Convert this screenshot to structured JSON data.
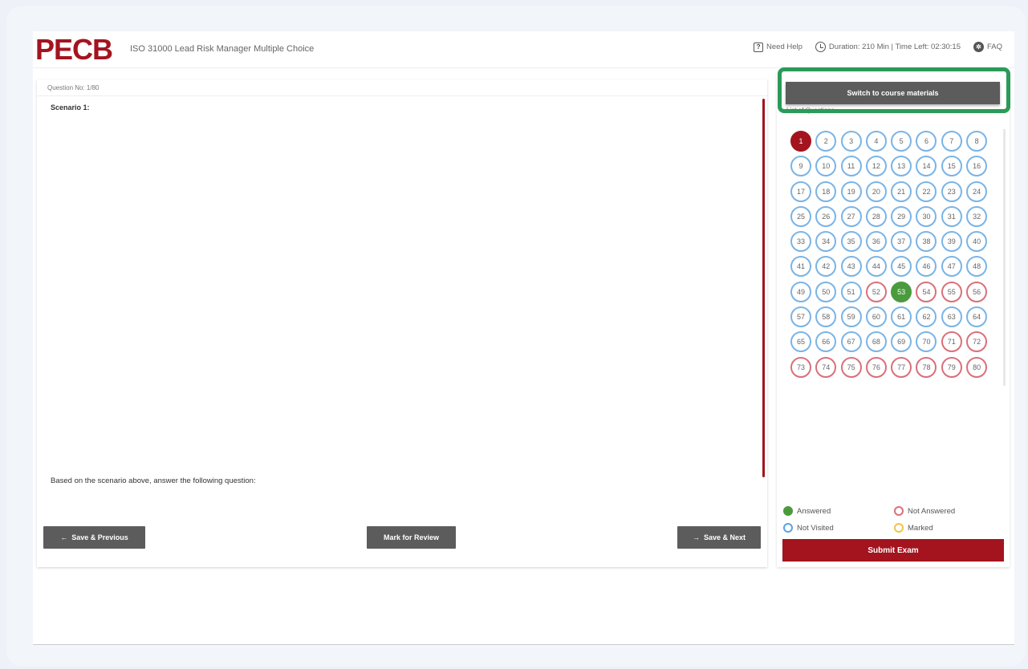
{
  "header": {
    "logo": "PECB",
    "exam_title": "ISO 31000 Lead Risk Manager Multiple Choice",
    "need_help": "Need Help",
    "duration": "Duration: 210 Min | Time Left: 02:30:15",
    "faq": "FAQ"
  },
  "question": {
    "number_label": "Question No: 1/80",
    "scenario_title": "Scenario 1:",
    "prompt": "Based on the scenario above, answer the following question:"
  },
  "nav": {
    "prev_label": "Save & Previous",
    "review_label": "Mark for Review",
    "next_label": "Save & Next"
  },
  "sidebar": {
    "switch_label": "Switch to course materials",
    "list_label": "List of Questions",
    "questions": [
      {
        "n": "1",
        "s": "current"
      },
      {
        "n": "2",
        "s": "not-visited"
      },
      {
        "n": "3",
        "s": "not-visited"
      },
      {
        "n": "4",
        "s": "not-visited"
      },
      {
        "n": "5",
        "s": "not-visited"
      },
      {
        "n": "6",
        "s": "not-visited"
      },
      {
        "n": "7",
        "s": "not-visited"
      },
      {
        "n": "8",
        "s": "not-visited"
      },
      {
        "n": "9",
        "s": "not-visited"
      },
      {
        "n": "10",
        "s": "not-visited"
      },
      {
        "n": "11",
        "s": "not-visited"
      },
      {
        "n": "12",
        "s": "not-visited"
      },
      {
        "n": "13",
        "s": "not-visited"
      },
      {
        "n": "14",
        "s": "not-visited"
      },
      {
        "n": "15",
        "s": "not-visited"
      },
      {
        "n": "16",
        "s": "not-visited"
      },
      {
        "n": "17",
        "s": "not-visited"
      },
      {
        "n": "18",
        "s": "not-visited"
      },
      {
        "n": "19",
        "s": "not-visited"
      },
      {
        "n": "20",
        "s": "not-visited"
      },
      {
        "n": "21",
        "s": "not-visited"
      },
      {
        "n": "22",
        "s": "not-visited"
      },
      {
        "n": "23",
        "s": "not-visited"
      },
      {
        "n": "24",
        "s": "not-visited"
      },
      {
        "n": "25",
        "s": "not-visited"
      },
      {
        "n": "26",
        "s": "not-visited"
      },
      {
        "n": "27",
        "s": "not-visited"
      },
      {
        "n": "28",
        "s": "not-visited"
      },
      {
        "n": "29",
        "s": "not-visited"
      },
      {
        "n": "30",
        "s": "not-visited"
      },
      {
        "n": "31",
        "s": "not-visited"
      },
      {
        "n": "32",
        "s": "not-visited"
      },
      {
        "n": "33",
        "s": "not-visited"
      },
      {
        "n": "34",
        "s": "not-visited"
      },
      {
        "n": "35",
        "s": "not-visited"
      },
      {
        "n": "36",
        "s": "not-visited"
      },
      {
        "n": "37",
        "s": "not-visited"
      },
      {
        "n": "38",
        "s": "not-visited"
      },
      {
        "n": "39",
        "s": "not-visited"
      },
      {
        "n": "40",
        "s": "not-visited"
      },
      {
        "n": "41",
        "s": "not-visited"
      },
      {
        "n": "42",
        "s": "not-visited"
      },
      {
        "n": "43",
        "s": "not-visited"
      },
      {
        "n": "44",
        "s": "not-visited"
      },
      {
        "n": "45",
        "s": "not-visited"
      },
      {
        "n": "46",
        "s": "not-visited"
      },
      {
        "n": "47",
        "s": "not-visited"
      },
      {
        "n": "48",
        "s": "not-visited"
      },
      {
        "n": "49",
        "s": "not-visited"
      },
      {
        "n": "50",
        "s": "not-visited"
      },
      {
        "n": "51",
        "s": "not-visited"
      },
      {
        "n": "52",
        "s": "not-answered"
      },
      {
        "n": "53",
        "s": "answered"
      },
      {
        "n": "54",
        "s": "not-answered"
      },
      {
        "n": "55",
        "s": "not-answered"
      },
      {
        "n": "56",
        "s": "not-answered"
      },
      {
        "n": "57",
        "s": "not-visited"
      },
      {
        "n": "58",
        "s": "not-visited"
      },
      {
        "n": "59",
        "s": "not-visited"
      },
      {
        "n": "60",
        "s": "not-visited"
      },
      {
        "n": "61",
        "s": "not-visited"
      },
      {
        "n": "62",
        "s": "not-visited"
      },
      {
        "n": "63",
        "s": "not-visited"
      },
      {
        "n": "64",
        "s": "not-visited"
      },
      {
        "n": "65",
        "s": "not-visited"
      },
      {
        "n": "66",
        "s": "not-visited"
      },
      {
        "n": "67",
        "s": "not-visited"
      },
      {
        "n": "68",
        "s": "not-visited"
      },
      {
        "n": "69",
        "s": "not-visited"
      },
      {
        "n": "70",
        "s": "not-visited"
      },
      {
        "n": "71",
        "s": "not-answered"
      },
      {
        "n": "72",
        "s": "not-answered"
      },
      {
        "n": "73",
        "s": "not-answered"
      },
      {
        "n": "74",
        "s": "not-answered"
      },
      {
        "n": "75",
        "s": "not-answered"
      },
      {
        "n": "76",
        "s": "not-answered"
      },
      {
        "n": "77",
        "s": "not-answered"
      },
      {
        "n": "78",
        "s": "not-answered"
      },
      {
        "n": "79",
        "s": "not-answered"
      },
      {
        "n": "80",
        "s": "not-answered"
      }
    ],
    "legend": {
      "answered": "Answered",
      "not_answered": "Not Answered",
      "not_visited": "Not Visited",
      "marked": "Marked"
    },
    "submit_label": "Submit Exam"
  },
  "colors": {
    "brand": "#a3141f",
    "answered": "#4b9a3e",
    "not_answered": "#d9707a",
    "not_visited": "#7ab4e6",
    "marked": "#f0c34b",
    "highlight": "#2a9b59"
  },
  "icons": {
    "help": "help-square-icon",
    "clock": "clock-icon",
    "faq": "faq-globe-icon",
    "prev": "arrow-left-icon",
    "next": "arrow-right-icon"
  }
}
